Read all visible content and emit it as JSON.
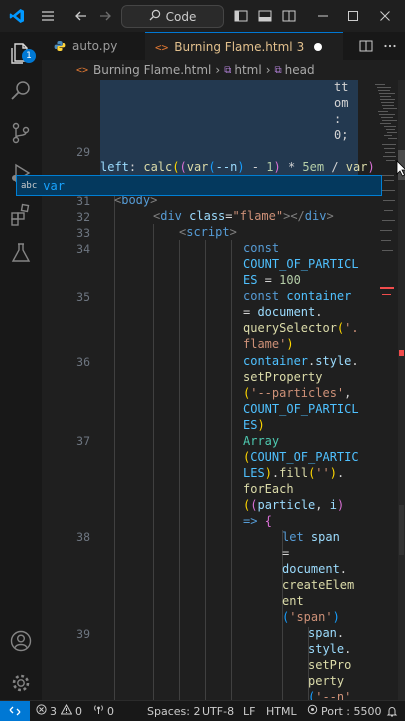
{
  "titlebar": {
    "command_center_label": "Code",
    "icons": [
      "vscode-logo-icon",
      "menu-icon",
      "back-arrow-icon",
      "forward-arrow-icon",
      "search-icon",
      "layout-sidebar-icon",
      "layout-panel-icon",
      "layout-split-icon",
      "minimize-icon",
      "maximize-icon",
      "close-icon"
    ]
  },
  "activity_bar": {
    "explorer_badge": "1",
    "icons": [
      "explorer-icon",
      "search-icon",
      "source-control-icon",
      "run-debug-icon",
      "extensions-icon",
      "testing-icon",
      "account-icon",
      "settings-gear-icon"
    ]
  },
  "tabs": [
    {
      "label": "auto.py",
      "icon": "python-file-icon",
      "active": false
    },
    {
      "label": "Burning Flame.html",
      "problems": "3",
      "icon": "html-file-icon",
      "active": true,
      "dirty": true
    }
  ],
  "editor_actions": [
    "split-editor-icon",
    "more-actions-icon"
  ],
  "breadcrumbs": [
    "Burning Flame.html",
    "html",
    "head"
  ],
  "editor": {
    "line_numbers": [
      "29",
      "31",
      "32",
      "33",
      "34",
      "35",
      "36",
      "37",
      "38",
      "39"
    ],
    "hidden_fragment": [
      "tt",
      "om",
      ":",
      "0;"
    ],
    "suggestion": {
      "icon_label": "abc",
      "text": "var"
    }
  },
  "colors": {
    "accent": "#0078d4",
    "editor_bg": "#1f1f1f",
    "selection": "#264f78",
    "suggest_bg": "#04395e"
  },
  "statusbar": {
    "remote_icon": "remote-icon",
    "errors": "3",
    "warnings": "0",
    "ports_count": "0",
    "spaces": "Spaces: 2",
    "encoding": "UTF-8",
    "eol": "LF",
    "language": "HTML",
    "port": "Port : 5500",
    "notifications_icon": "bell-icon"
  }
}
